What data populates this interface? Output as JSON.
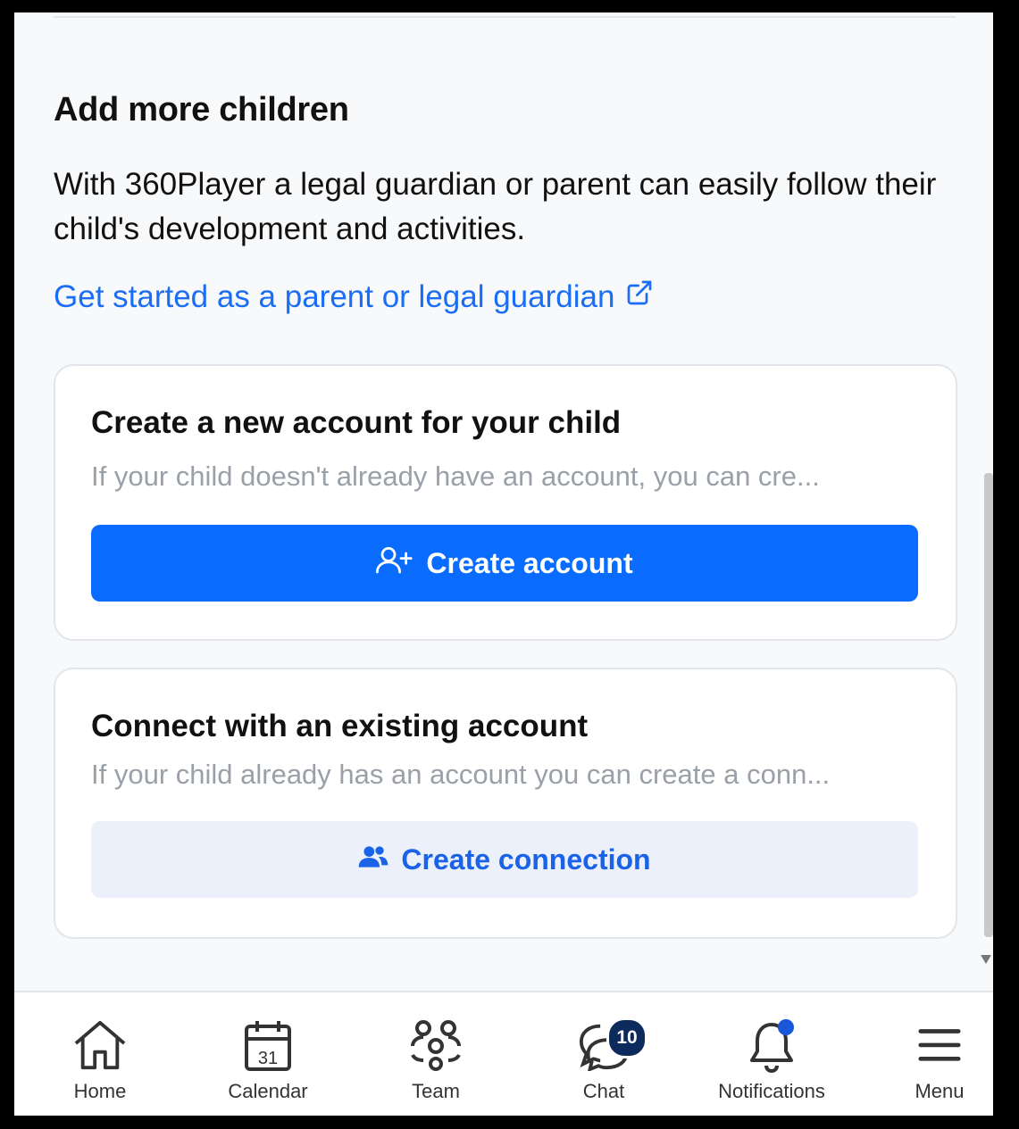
{
  "section": {
    "title": "Add more children",
    "description": "With 360Player a legal guardian or parent can easily follow their child's development and activities.",
    "link_text": "Get started as a parent or legal guardian"
  },
  "cards": [
    {
      "title": "Create a new account for your child",
      "description": "If your child doesn't already have an account, you can cre...",
      "button_label": "Create account"
    },
    {
      "title": "Connect with an existing account",
      "description": "If your child already has an account you can create a conn...",
      "button_label": "Create connection"
    }
  ],
  "nav": {
    "home": "Home",
    "calendar": "Calendar",
    "calendar_day": "31",
    "team": "Team",
    "chat": "Chat",
    "chat_badge": "10",
    "notifications": "Notifications",
    "menu": "Menu"
  },
  "colors": {
    "primary": "#0a6cff",
    "link": "#1a6df5",
    "secondary_bg": "#ebf0fb",
    "badge": "#0d2a5c"
  }
}
